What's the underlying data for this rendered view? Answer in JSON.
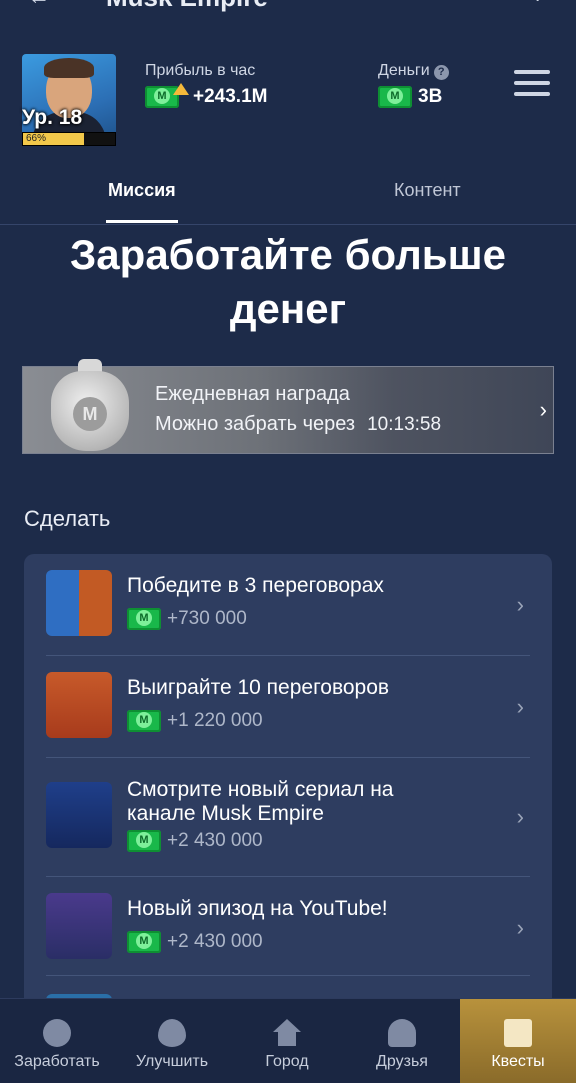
{
  "app": {
    "title": "Musk Empire"
  },
  "profile": {
    "level_label": "Ур. 18",
    "level_progress_pct": 66,
    "progress_label": "66%"
  },
  "stats": {
    "profit_label": "Прибыль в час",
    "profit_value": "+243.1M",
    "money_label": "Деньги",
    "money_value": "3B"
  },
  "tabs": [
    {
      "label": "Миссия",
      "active": true
    },
    {
      "label": "Контент",
      "active": false
    }
  ],
  "headline": "Заработайте больше денег",
  "daily": {
    "title": "Ежедневная награда",
    "subtitle": "Можно забрать через",
    "countdown": "10:13:58"
  },
  "section_title": "Сделать",
  "tasks": [
    {
      "title": "Победите в 3 переговорах",
      "reward": "+730 000"
    },
    {
      "title": "Выиграйте 10 переговоров",
      "reward": "+1 220 000"
    },
    {
      "title": "Смотрите новый сериал на канале Musk Empire",
      "reward": "+2 430 000"
    },
    {
      "title": "Новый эпизод на YouTube!",
      "reward": "+2 430 000"
    }
  ],
  "nav": [
    {
      "label": "Заработать",
      "icon": "thumbs-up-icon"
    },
    {
      "label": "Улучшить",
      "icon": "flame-icon"
    },
    {
      "label": "Город",
      "icon": "house-icon"
    },
    {
      "label": "Друзья",
      "icon": "users-icon"
    },
    {
      "label": "Квесты",
      "icon": "clipboard-icon",
      "active": true
    }
  ]
}
